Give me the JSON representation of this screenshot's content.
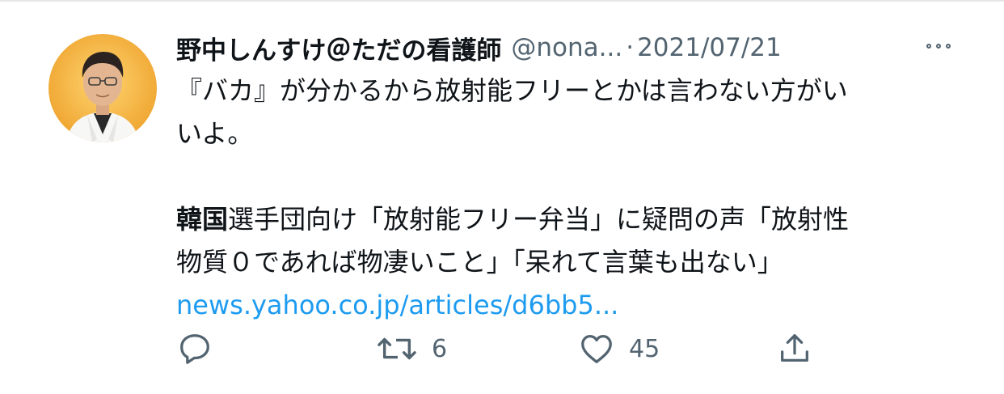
{
  "tweet": {
    "display_name": "野中しんすけ＠ただの看護師",
    "handle": "@nona...",
    "separator": "·",
    "timestamp": "2021/07/21",
    "more_icon": "more-horizontal-icon",
    "body": {
      "line1": "『バカ』が分かるから放射能フリーとかは言わない方がい",
      "line2": "いよ。",
      "line3_bold": "韓国",
      "line3_rest": "選手団向け「放射能フリー弁当」に疑問の声「放射性",
      "line4": "物質０であれば物凄いこと」「呆れて言葉も出ない」",
      "link": "news.yahoo.co.jp/articles/d6bb5..."
    },
    "actions": {
      "reply_icon": "reply-icon",
      "retweet_icon": "retweet-icon",
      "retweet_count": "6",
      "like_icon": "heart-icon",
      "like_count": "45",
      "share_icon": "share-icon"
    },
    "colors": {
      "text": "#0f1419",
      "secondary": "#536471",
      "link": "#1d9bf0",
      "avatar_bg": "#f0a835"
    }
  }
}
